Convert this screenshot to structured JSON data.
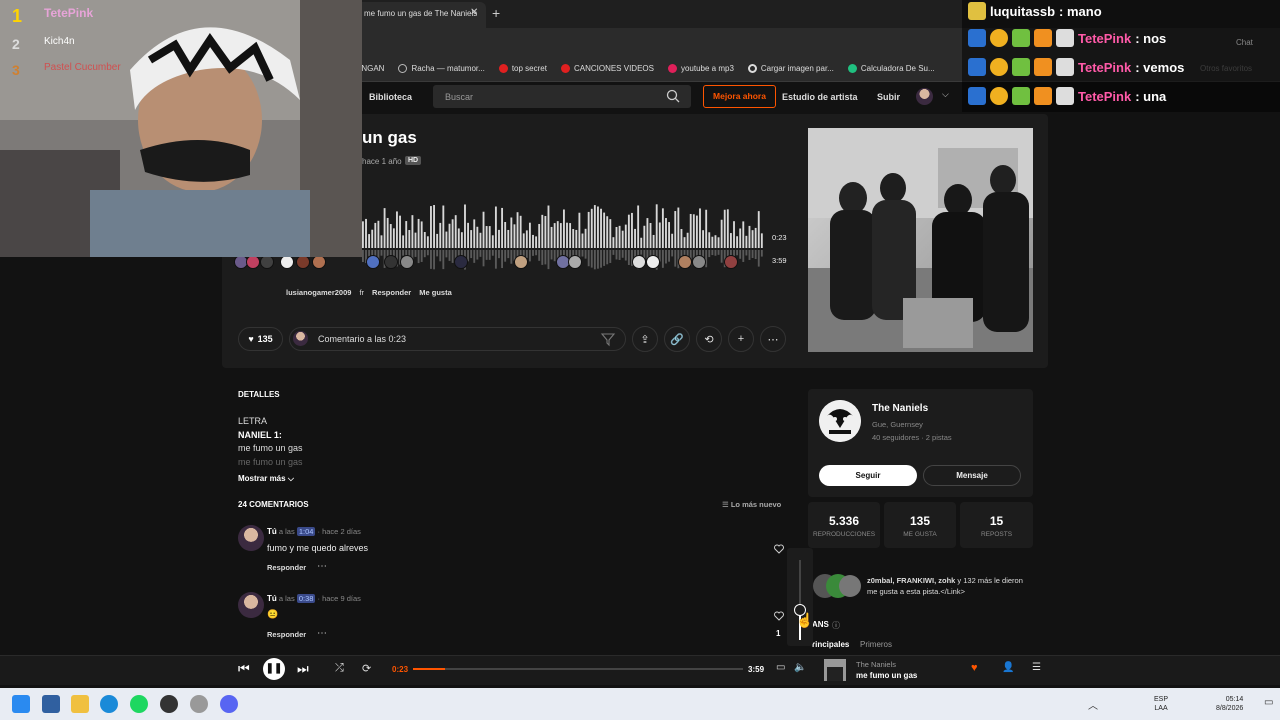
{
  "browser": {
    "active_tab": "me fumo un gas de The Naniels",
    "bookmarks": [
      {
        "label": "ENGAN",
        "color": ""
      },
      {
        "label": "Racha — matumor...",
        "color": "#999999"
      },
      {
        "label": "top secret",
        "color": "#e02020"
      },
      {
        "label": "CANCIONES VIDEOS",
        "color": "#e02020"
      },
      {
        "label": "youtube a mp3",
        "color": "#e0205a"
      },
      {
        "label": "Cargar imagen par...",
        "color": "#dddddd"
      },
      {
        "label": "Calculadora De Su...",
        "color": "#20c080"
      }
    ],
    "other_bookmarks": "Otros favoritos"
  },
  "header": {
    "library": "Biblioteca",
    "search_placeholder": "Buscar",
    "upgrade": "Mejora ahora",
    "artist_studio": "Estudio de artista",
    "upload": "Subir"
  },
  "track": {
    "title": "un gas",
    "age": "hace 1 año",
    "hd": "HD",
    "current_time": "0:23",
    "total_time": "3:59",
    "progress": 0.096,
    "wave_comment": {
      "user": "lusianogamer2009",
      "text": "fr",
      "reply": "Responder",
      "like": "Me gusta"
    }
  },
  "actions": {
    "likes": "135",
    "comment_placeholder": "Comentario a las 0:23"
  },
  "details": {
    "heading": "DETALLES",
    "lyrics_label": "LETRA",
    "lines": [
      "NANIEL 1:",
      "me fumo un gas",
      "me fumo un gas"
    ],
    "show_more": "Mostrar más"
  },
  "comments": {
    "heading": "24 COMENTARIOS",
    "sort": "Lo más nuevo",
    "items": [
      {
        "user": "Tú",
        "at": "a las",
        "ts": "1:04",
        "when": "hace 2 días",
        "text": "fumo y me quedo alreves",
        "reply": "Responder"
      },
      {
        "user": "Tú",
        "at": "a las",
        "ts": "0:38",
        "when": "hace 9 días",
        "text": "😐",
        "reply": "Responder",
        "likes": "1"
      }
    ]
  },
  "artist": {
    "name": "The Naniels",
    "location": "Gue, Guernsey",
    "stats": "40 seguidores · 2 pistas",
    "follow": "Seguir",
    "message": "Mensaje"
  },
  "stats": [
    {
      "value": "5.336",
      "label": "REPRODUCCIONES"
    },
    {
      "value": "135",
      "label": "ME GUSTA"
    },
    {
      "value": "15",
      "label": "REPOSTS"
    }
  ],
  "likers": {
    "names": "z0mbal, FRANKIWI, zohk",
    "rest": " y 132 más le dieron me gusta a esta pista.</Link>"
  },
  "fans": {
    "label": "ANS",
    "tab_main": "rincipales",
    "tab_first": "Primeros"
  },
  "volume": {
    "level": 0.38
  },
  "player": {
    "current": "0:23",
    "total": "3:59",
    "artist": "The Naniels",
    "title": "me fumo un gas"
  },
  "taskbar": {
    "lang": "ESP\nLAA",
    "time": "05:14",
    "date": "8/8/2026"
  },
  "stream": {
    "leaderboard": [
      {
        "rank": "1",
        "name": "TetePink"
      },
      {
        "rank": "2",
        "name": "Kich4n"
      },
      {
        "rank": "3",
        "name": "Pastel Cucumber"
      }
    ],
    "chat": [
      {
        "user": "luquitassb",
        "msg": "mano"
      },
      {
        "user": "TetePink",
        "msg": "nos"
      },
      {
        "user": "TetePink",
        "msg": "vemos"
      },
      {
        "user": "TetePink",
        "msg": "una"
      }
    ],
    "chat_label": "Chat"
  }
}
